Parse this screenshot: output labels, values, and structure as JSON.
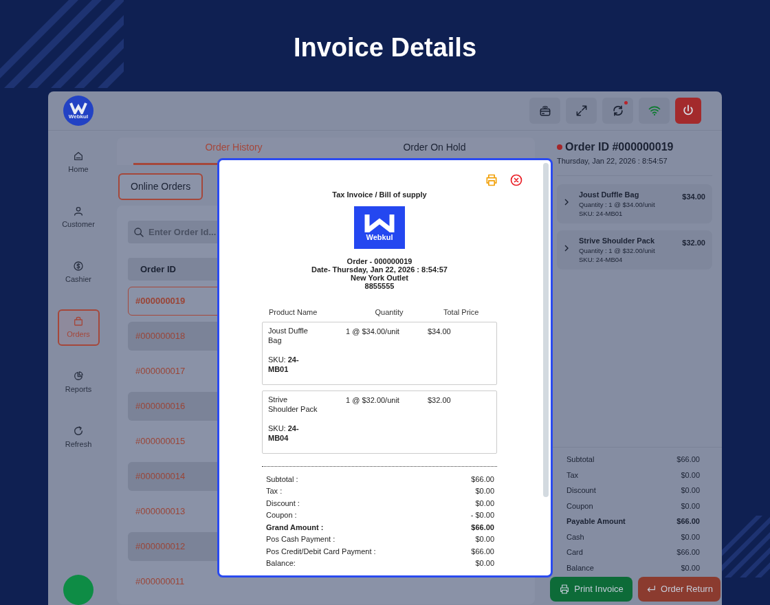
{
  "page_title": "Invoice Details",
  "app": {
    "logo": {
      "text": "Webkul"
    },
    "toolbar": [
      {
        "kind": "card-reader",
        "alert": false
      },
      {
        "kind": "expand",
        "alert": false
      },
      {
        "kind": "sync",
        "alert": true
      },
      {
        "kind": "wifi",
        "alert": false
      },
      {
        "kind": "power",
        "alert": false
      }
    ],
    "sidebar": [
      {
        "label": "Home",
        "selected": false
      },
      {
        "label": "Customer",
        "selected": false
      },
      {
        "label": "Cashier",
        "selected": false
      },
      {
        "label": "Orders",
        "selected": true
      },
      {
        "label": "Reports",
        "selected": false
      },
      {
        "label": "Refresh",
        "selected": false
      }
    ],
    "tabs": [
      {
        "label": "Order History",
        "selected": true
      },
      {
        "label": "Order On Hold",
        "selected": false
      }
    ],
    "filter_button": "Online Orders",
    "search": {
      "placeholder": "Enter Order Id..."
    },
    "order_table": {
      "columns": [
        "Order ID"
      ],
      "rows": [
        {
          "id": "#000000019",
          "selected": true
        },
        {
          "id": "#000000018",
          "selected": false
        },
        {
          "id": "#000000017",
          "selected": false
        },
        {
          "id": "#000000016",
          "selected": false
        },
        {
          "id": "#000000015",
          "selected": false
        },
        {
          "id": "#000000014",
          "selected": false
        },
        {
          "id": "#000000013",
          "selected": false
        },
        {
          "id": "#000000012",
          "selected": false
        },
        {
          "id": "#000000011",
          "selected": false
        }
      ]
    },
    "order_panel": {
      "title": "Order ID #000000019",
      "date": "Thursday, Jan 22, 2026 : 8:54:57",
      "items": [
        {
          "name": "Joust Duffle Bag",
          "quantity": "Quantity : 1 @ $34.00/unit",
          "sku": "SKU: 24-MB01",
          "price": "$34.00"
        },
        {
          "name": "Strive Shoulder Pack",
          "quantity": "Quantity : 1 @ $32.00/unit",
          "sku": "SKU: 24-MB04",
          "price": "$32.00"
        }
      ],
      "totals": [
        {
          "label": "Subtotal",
          "value": "$66.00",
          "bold": false
        },
        {
          "label": "Tax",
          "value": "$0.00",
          "bold": false
        },
        {
          "label": "Discount",
          "value": "$0.00",
          "bold": false
        },
        {
          "label": "Coupon",
          "value": "$0.00",
          "bold": false
        },
        {
          "label": "Payable Amount",
          "value": "$66.00",
          "bold": true
        },
        {
          "label": "Cash",
          "value": "$0.00",
          "bold": false
        },
        {
          "label": "Card",
          "value": "$66.00",
          "bold": false
        },
        {
          "label": "Balance",
          "value": "$0.00",
          "bold": false
        }
      ],
      "buttons": [
        {
          "label": "Print Invoice",
          "kind": "print"
        },
        {
          "label": "Order Return",
          "kind": "return"
        }
      ]
    }
  },
  "invoice_modal": {
    "title": "Tax Invoice / Bill of supply",
    "logo_text": "Webkul",
    "header_lines": [
      "Order - 000000019",
      "Date- Thursday, Jan 22, 2026 : 8:54:57",
      "New York Outlet",
      "8855555"
    ],
    "columns": [
      "Product Name",
      "Quantity",
      "Total Price"
    ],
    "items": [
      {
        "name": "Joust Duffle Bag",
        "quantity": "1 @ $34.00/unit",
        "price": "$34.00",
        "sku": "SKU: **24-MB01**"
      },
      {
        "name": "Strive Shoulder Pack",
        "quantity": "1 @ $32.00/unit",
        "price": "$32.00",
        "sku": "SKU: **24-MB04**"
      }
    ],
    "totals": [
      {
        "label": "Subtotal :",
        "value": "$66.00",
        "bold": false
      },
      {
        "label": "Tax :",
        "value": "$0.00",
        "bold": false
      },
      {
        "label": "Discount :",
        "value": "$0.00",
        "bold": false
      },
      {
        "label": "Coupon :",
        "value": "- $0.00",
        "bold": false
      },
      {
        "label": "Grand Amount :",
        "value": "$66.00",
        "bold": true
      },
      {
        "label": "Pos Cash Payment :",
        "value": "$0.00",
        "bold": false
      },
      {
        "label": "Pos Credit/Debit Card Payment :",
        "value": "$66.00",
        "bold": false
      },
      {
        "label": "Balance:",
        "value": "$0.00",
        "bold": false
      }
    ]
  }
}
